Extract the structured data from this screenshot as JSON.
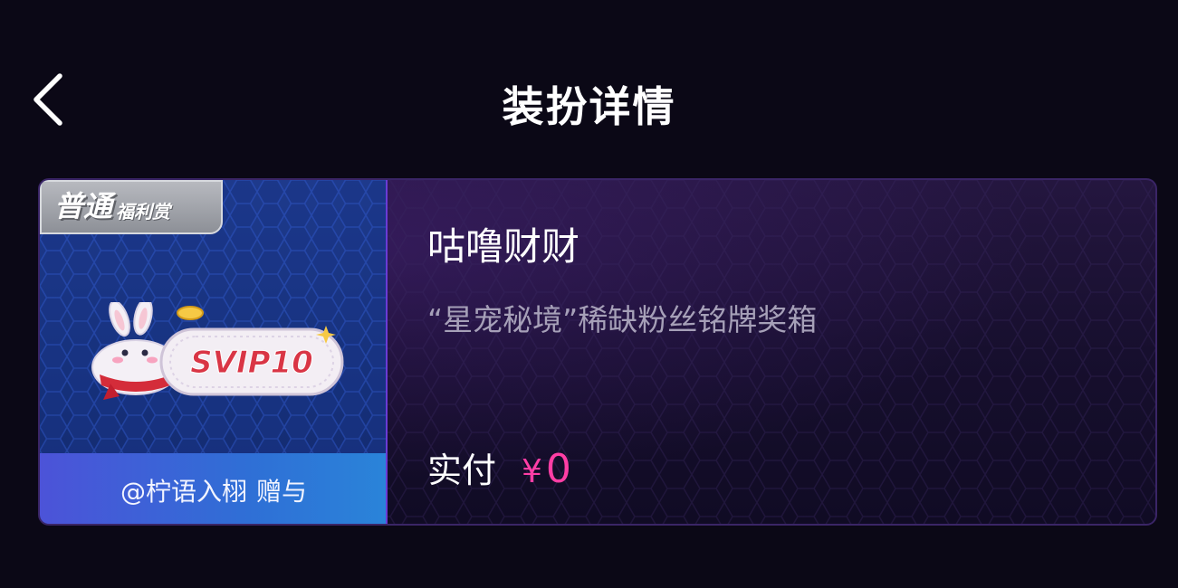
{
  "header": {
    "title": "装扮详情",
    "back_icon": "chevron-left-icon"
  },
  "card": {
    "tier_badge": {
      "main": "普通",
      "sub": "福利赏"
    },
    "medal_text": "SVIP10",
    "gift_from": "@柠语入栩",
    "gift_action": "赠与",
    "item_name": "咕噜财财",
    "item_desc": "“星宠秘境”稀缺粉丝铭牌奖箱",
    "price_label": "实付",
    "currency_symbol": "¥",
    "price_value": "0"
  },
  "colors": {
    "background": "#0b0816",
    "price_accent": "#ff3ea5",
    "gift_bar_start": "#4c53d8",
    "gift_bar_end": "#2a84d9"
  }
}
